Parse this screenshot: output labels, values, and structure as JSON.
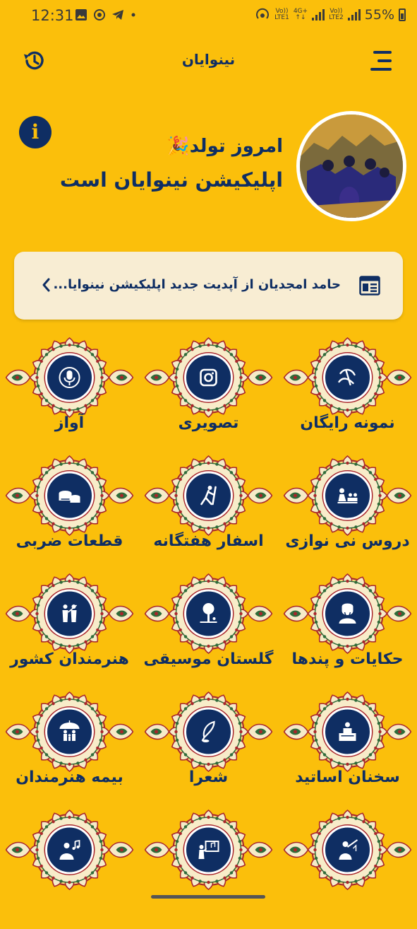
{
  "status_bar": {
    "time": "12:31",
    "battery": "55%",
    "sim1": {
      "top": "Vo))",
      "bottom": "LTE1"
    },
    "net": {
      "top": "4G+",
      "bottom": "↑↓"
    },
    "sim2": {
      "top": "Vo))",
      "bottom": "LTE2"
    },
    "notification_icons": [
      "image-icon",
      "candle-icon",
      "telegram-icon",
      "dot-icon"
    ]
  },
  "app_bar": {
    "title": "نینوایان",
    "left_icon": "history-icon",
    "right_icon": "menu-icon"
  },
  "hero": {
    "line1": "امروز تولد",
    "emoji": "🎉",
    "line2": "اپلیکیشن نینوایان است",
    "info_icon": "i"
  },
  "news": {
    "text": "حامد امجدیان از آپدیت جدید اپلیکیشن نینوایا...",
    "icon": "news-icon",
    "arrow": "chevron-left-icon"
  },
  "menu": [
    {
      "label": "نمونه رایگان",
      "icon": "free-calligraphy-icon"
    },
    {
      "label": "تصویری",
      "icon": "camera-icon"
    },
    {
      "label": "آواز",
      "icon": "microphone-icon"
    },
    {
      "label": "دروس نی نوازی",
      "icon": "classroom-icon"
    },
    {
      "label": "اسفار هفتگانه",
      "icon": "hiker-icon"
    },
    {
      "label": "قطعات ضربی",
      "icon": "drums-icon"
    },
    {
      "label": "حکایات و پندها",
      "icon": "sage-icon"
    },
    {
      "label": "گلستان موسیقی",
      "icon": "tree-reader-icon"
    },
    {
      "label": "هنرمندان کشور",
      "icon": "performers-icon"
    },
    {
      "label": "سخنان اساتید",
      "icon": "lecture-icon"
    },
    {
      "label": "شعرا",
      "icon": "quill-icon"
    },
    {
      "label": "بیمه هنرمندان",
      "icon": "family-umbrella-icon"
    },
    {
      "label": "",
      "icon": "flute-player-icon"
    },
    {
      "label": "",
      "icon": "music-teacher-icon"
    },
    {
      "label": "",
      "icon": "singer-icon"
    }
  ],
  "colors": {
    "background": "#FBBF0B",
    "primary": "#0F2E63",
    "card": "#F8EDD3",
    "ornament_red": "#A8262B",
    "ornament_green": "#2F6B3A",
    "ornament_cream": "#F6EBC8"
  }
}
